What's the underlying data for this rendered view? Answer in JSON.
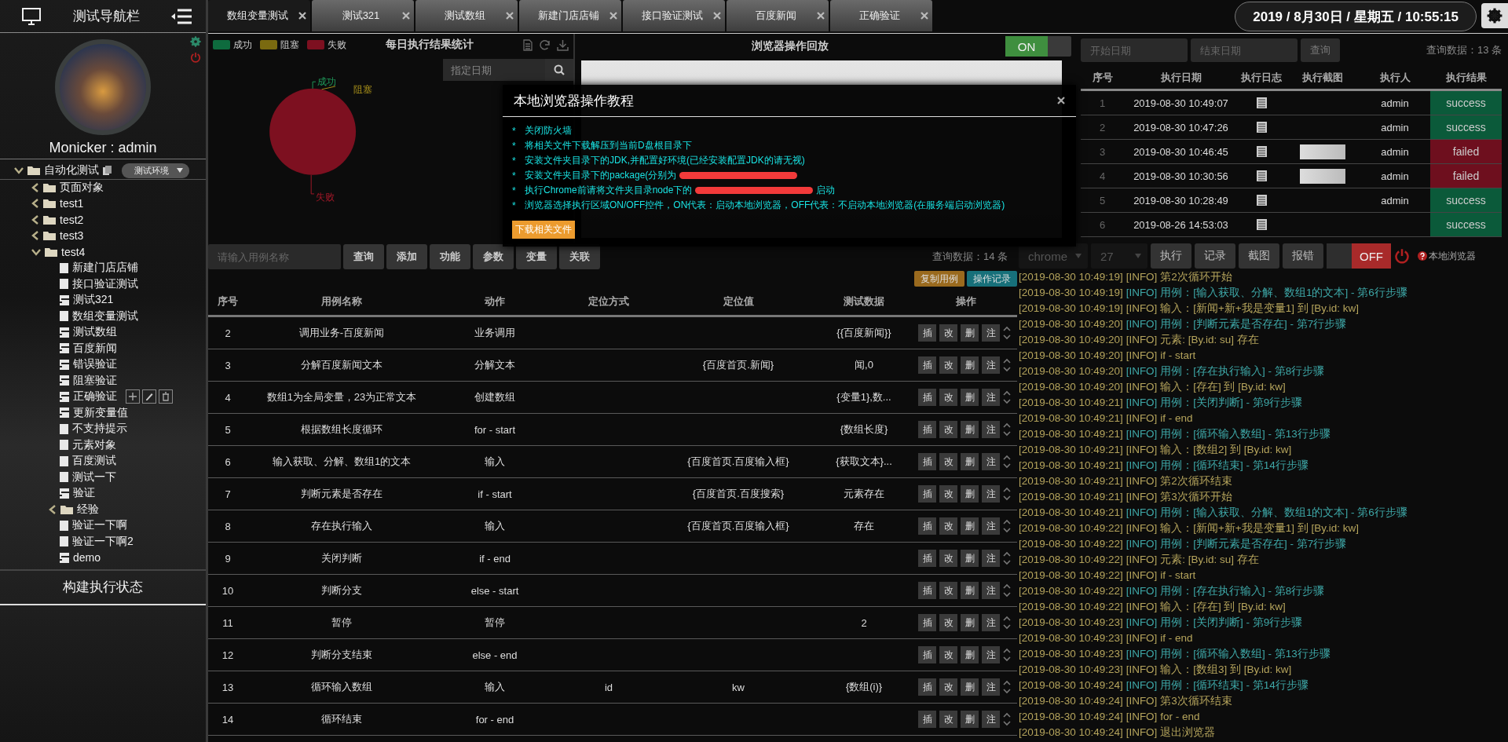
{
  "sidebar": {
    "title": "测试导航栏",
    "user": "Monicker : admin",
    "section": "构建执行状态",
    "tree": [
      {
        "label": "自动化测试",
        "kind": "folder",
        "expanded": true,
        "env": "测试环境",
        "children": [
          {
            "label": "页面对象",
            "kind": "folder",
            "expanded": false
          },
          {
            "label": "test1",
            "kind": "folder",
            "expanded": false
          },
          {
            "label": "test2",
            "kind": "folder",
            "expanded": false
          },
          {
            "label": "test3",
            "kind": "folder",
            "expanded": false
          },
          {
            "label": "test4",
            "kind": "folder",
            "expanded": true,
            "children": [
              {
                "label": "新建门店店铺",
                "kind": "doc",
                "hovered": false
              },
              {
                "label": "接口验证测试",
                "kind": "doc",
                "hovered": false
              },
              {
                "label": "测试321",
                "kind": "script",
                "hovered": false
              },
              {
                "label": "数组变量测试",
                "kind": "doc",
                "hovered": false
              },
              {
                "label": "测试数组",
                "kind": "script",
                "hovered": false
              },
              {
                "label": "百度新闻",
                "kind": "script",
                "hovered": false
              },
              {
                "label": "错误验证",
                "kind": "script",
                "hovered": false
              },
              {
                "label": "阻塞验证",
                "kind": "script",
                "hovered": false
              },
              {
                "label": "正确验证",
                "kind": "script",
                "hovered": true
              },
              {
                "label": "更新变量值",
                "kind": "script",
                "hovered": false
              },
              {
                "label": "不支持提示",
                "kind": "doc",
                "hovered": false
              },
              {
                "label": "元素对象",
                "kind": "doc",
                "hovered": false
              },
              {
                "label": "百度测试",
                "kind": "doc",
                "hovered": false
              },
              {
                "label": "测试一下",
                "kind": "doc",
                "hovered": false
              },
              {
                "label": "验证",
                "kind": "script",
                "hovered": false
              },
              {
                "label": "经验",
                "kind": "folder",
                "expanded": false
              },
              {
                "label": "验证一下啊",
                "kind": "doc",
                "hovered": false
              },
              {
                "label": "验证一下啊2",
                "kind": "doc",
                "hovered": false
              },
              {
                "label": "demo",
                "kind": "script",
                "hovered": false
              }
            ]
          }
        ]
      }
    ]
  },
  "tabs": [
    {
      "label": "数组变量测试",
      "selected": true
    },
    {
      "label": "测试321",
      "selected": false
    },
    {
      "label": "测试数组",
      "selected": false
    },
    {
      "label": "新建门店店铺",
      "selected": false
    },
    {
      "label": "接口验证测试",
      "selected": false
    },
    {
      "label": "百度新闻",
      "selected": false
    },
    {
      "label": "正确验证",
      "selected": false
    }
  ],
  "datetime": "2019 / 8月30日 / 星期五 / 10:55:15",
  "stats": {
    "title": "每日执行结果统计",
    "date_placeholder": "指定日期",
    "legend": [
      {
        "label": "成功",
        "color": "#0e6b3e"
      },
      {
        "label": "阻塞",
        "color": "#7a6a10"
      },
      {
        "label": "失败",
        "color": "#7d1020"
      }
    ],
    "pie_labels": [
      {
        "label": "成功",
        "color": "#1f9a5a"
      },
      {
        "label": "阻塞",
        "color": "#a8901a"
      },
      {
        "label": "失败",
        "color": "#a01828"
      }
    ]
  },
  "replay": {
    "title": "浏览器操作回放",
    "toggle": {
      "label": "ON",
      "on": true
    }
  },
  "results": {
    "start_placeholder": "开始日期",
    "end_placeholder": "结束日期",
    "query": "查询",
    "count": "查询数据：13 条",
    "columns": [
      "序号",
      "执行日期",
      "执行日志",
      "执行截图",
      "执行人",
      "执行结果"
    ],
    "rows": [
      {
        "index": "1",
        "date": "2019-08-30 10:49:07",
        "screenshot": false,
        "user": "admin",
        "result": "success",
        "color": "#0b5a3a"
      },
      {
        "index": "2",
        "date": "2019-08-30 10:47:26",
        "screenshot": false,
        "user": "admin",
        "result": "success",
        "color": "#0b5a3a"
      },
      {
        "index": "3",
        "date": "2019-08-30 10:46:45",
        "screenshot": true,
        "user": "admin",
        "result": "failed",
        "color": "#6e0f1e"
      },
      {
        "index": "4",
        "date": "2019-08-30 10:30:56",
        "screenshot": true,
        "user": "admin",
        "result": "failed",
        "color": "#6e0f1e"
      },
      {
        "index": "5",
        "date": "2019-08-30 10:28:49",
        "screenshot": false,
        "user": "admin",
        "result": "success",
        "color": "#0b5a3a"
      },
      {
        "index": "6",
        "date": "2019-08-26 14:53:03",
        "screenshot": false,
        "result": "success",
        "color": "#0b5a3a"
      }
    ]
  },
  "cases": {
    "search_placeholder": "请输入用例名称",
    "buttons": [
      "查询",
      "添加",
      "功能",
      "参数",
      "变量",
      "关联"
    ],
    "count": "查询数据：14 条",
    "extra_buttons": [
      {
        "label": "复制用例",
        "color": "#9a6a1e"
      },
      {
        "label": "操作记录",
        "color": "#17707a"
      }
    ],
    "columns": [
      "序号",
      "用例名称",
      "动作",
      "定位方式",
      "定位值",
      "测试数据",
      "操作"
    ],
    "rows": [
      {
        "no": "2",
        "name": "调用业务-百度新闻",
        "action": "业务调用",
        "test_data": "{{百度新闻}}",
        "actions": [
          "插",
          "改",
          "删",
          "注"
        ]
      },
      {
        "no": "3",
        "name": "分解百度新闻文本",
        "action": "分解文本",
        "locator_value": "{百度首页.新闻}",
        "test_data": "闻,0",
        "actions": [
          "插",
          "改",
          "删",
          "注"
        ]
      },
      {
        "no": "4",
        "name": "数组1为全局变量，23为正常文本",
        "action": "创建数组",
        "test_data": "{变量1},数...",
        "actions": [
          "插",
          "改",
          "删",
          "注"
        ]
      },
      {
        "no": "5",
        "name": "根据数组长度循环",
        "action": "for - start",
        "test_data": "{数组长度}",
        "actions": [
          "插",
          "改",
          "删",
          "注"
        ]
      },
      {
        "no": "6",
        "name": "输入获取、分解、数组1的文本",
        "action": "输入",
        "locator_value": "{百度首页.百度输入框}",
        "test_data": "{获取文本}...",
        "actions": [
          "插",
          "改",
          "删",
          "注"
        ]
      },
      {
        "no": "7",
        "name": "判断元素是否存在",
        "action": "if - start",
        "locator_value": "{百度首页.百度搜索}",
        "test_data": "元素存在",
        "actions": [
          "插",
          "改",
          "删",
          "注"
        ]
      },
      {
        "no": "8",
        "name": "存在执行输入",
        "action": "输入",
        "locator_value": "{百度首页.百度输入框}",
        "test_data": "存在",
        "actions": [
          "插",
          "改",
          "删",
          "注"
        ]
      },
      {
        "no": "9",
        "name": "关闭判断",
        "action": "if - end",
        "actions": [
          "插",
          "改",
          "删",
          "注"
        ]
      },
      {
        "no": "10",
        "name": "判断分支",
        "action": "else - start",
        "actions": [
          "插",
          "改",
          "删",
          "注"
        ]
      },
      {
        "no": "11",
        "name": "暂停",
        "action": "暂停",
        "test_data": "2",
        "actions": [
          "插",
          "改",
          "删",
          "注"
        ]
      },
      {
        "no": "12",
        "name": "判断分支结束",
        "action": "else - end",
        "actions": [
          "插",
          "改",
          "删",
          "注"
        ]
      },
      {
        "no": "13",
        "name": "循环输入数组",
        "action": "输入",
        "locator_type": "id",
        "locator_value": "kw",
        "test_data": "{数组(i)}",
        "actions": [
          "插",
          "改",
          "删",
          "注"
        ]
      },
      {
        "no": "14",
        "name": "循环结束",
        "action": "for - end",
        "actions": [
          "插",
          "改",
          "删",
          "注"
        ]
      }
    ]
  },
  "browser": {
    "selects": [
      "chrome",
      "27"
    ],
    "buttons": [
      "执行",
      "记录",
      "截图",
      "报错"
    ],
    "toggle": {
      "label": "OFF",
      "on": false
    },
    "help": "本地浏览器"
  },
  "log": [
    {
      "time": "[2019-08-30 10:49:19]",
      "level": "[INFO]",
      "message": "第2次循环开始",
      "kind": "info"
    },
    {
      "time": "[2019-08-30 10:49:19]",
      "level": "[INFO]",
      "message": "用例：[输入获取、分解、数组1的文本] - 第6行步骤",
      "kind": "case"
    },
    {
      "time": "[2019-08-30 10:49:19]",
      "level": "[INFO]",
      "message": "输入：[新闻+新+我是变量1] 到 [By.id: kw]",
      "kind": "info"
    },
    {
      "time": "[2019-08-30 10:49:20]",
      "level": "[INFO]",
      "message": "用例：[判断元素是否存在] - 第7行步骤",
      "kind": "case"
    },
    {
      "time": "[2019-08-30 10:49:20]",
      "level": "[INFO]",
      "message": "元素: [By.id: su] 存在",
      "kind": "info"
    },
    {
      "time": "[2019-08-30 10:49:20]",
      "level": "[INFO]",
      "message": "if - start",
      "kind": "info"
    },
    {
      "time": "[2019-08-30 10:49:20]",
      "level": "[INFO]",
      "message": "用例：[存在执行输入] - 第8行步骤",
      "kind": "case"
    },
    {
      "time": "[2019-08-30 10:49:20]",
      "level": "[INFO]",
      "message": "输入：[存在] 到 [By.id: kw]",
      "kind": "info"
    },
    {
      "time": "[2019-08-30 10:49:21]",
      "level": "[INFO]",
      "message": "用例：[关闭判断] - 第9行步骤",
      "kind": "case"
    },
    {
      "time": "[2019-08-30 10:49:21]",
      "level": "[INFO]",
      "message": "if - end",
      "kind": "info"
    },
    {
      "time": "[2019-08-30 10:49:21]",
      "level": "[INFO]",
      "message": "用例：[循环输入数组] - 第13行步骤",
      "kind": "case"
    },
    {
      "time": "[2019-08-30 10:49:21]",
      "level": "[INFO]",
      "message": "输入：[数组2] 到 [By.id: kw]",
      "kind": "info"
    },
    {
      "time": "[2019-08-30 10:49:21]",
      "level": "[INFO]",
      "message": "用例：[循环结束] - 第14行步骤",
      "kind": "case"
    },
    {
      "time": "[2019-08-30 10:49:21]",
      "level": "[INFO]",
      "message": "第2次循环结束",
      "kind": "info"
    },
    {
      "time": "[2019-08-30 10:49:21]",
      "level": "[INFO]",
      "message": "第3次循环开始",
      "kind": "info"
    },
    {
      "time": "[2019-08-30 10:49:21]",
      "level": "[INFO]",
      "message": "用例：[输入获取、分解、数组1的文本] - 第6行步骤",
      "kind": "case"
    },
    {
      "time": "[2019-08-30 10:49:22]",
      "level": "[INFO]",
      "message": "输入：[新闻+新+我是变量1] 到 [By.id: kw]",
      "kind": "info"
    },
    {
      "time": "[2019-08-30 10:49:22]",
      "level": "[INFO]",
      "message": "用例：[判断元素是否存在] - 第7行步骤",
      "kind": "case"
    },
    {
      "time": "[2019-08-30 10:49:22]",
      "level": "[INFO]",
      "message": "元素: [By.id: su] 存在",
      "kind": "info"
    },
    {
      "time": "[2019-08-30 10:49:22]",
      "level": "[INFO]",
      "message": "if - start",
      "kind": "info"
    },
    {
      "time": "[2019-08-30 10:49:22]",
      "level": "[INFO]",
      "message": "用例：[存在执行输入] - 第8行步骤",
      "kind": "case"
    },
    {
      "time": "[2019-08-30 10:49:22]",
      "level": "[INFO]",
      "message": "输入：[存在] 到 [By.id: kw]",
      "kind": "info"
    },
    {
      "time": "[2019-08-30 10:49:23]",
      "level": "[INFO]",
      "message": "用例：[关闭判断] - 第9行步骤",
      "kind": "case"
    },
    {
      "time": "[2019-08-30 10:49:23]",
      "level": "[INFO]",
      "message": "if - end",
      "kind": "info"
    },
    {
      "time": "[2019-08-30 10:49:23]",
      "level": "[INFO]",
      "message": "用例：[循环输入数组] - 第13行步骤",
      "kind": "case"
    },
    {
      "time": "[2019-08-30 10:49:23]",
      "level": "[INFO]",
      "message": "输入：[数组3] 到 [By.id: kw]",
      "kind": "info"
    },
    {
      "time": "[2019-08-30 10:49:24]",
      "level": "[INFO]",
      "message": "用例：[循环结束] - 第14行步骤",
      "kind": "case"
    },
    {
      "time": "[2019-08-30 10:49:24]",
      "level": "[INFO]",
      "message": "第3次循环结束",
      "kind": "info"
    },
    {
      "time": "[2019-08-30 10:49:24]",
      "level": "[INFO]",
      "message": "for - end",
      "kind": "info"
    },
    {
      "time": "[2019-08-30 10:49:24]",
      "level": "[INFO]",
      "message": "退出浏览器",
      "kind": "info"
    }
  ],
  "modal": {
    "title": "本地浏览器操作教程",
    "download": "下载相关文件",
    "items": [
      {
        "bullet": "*",
        "text": "关闭防火墙",
        "redacted": false
      },
      {
        "bullet": "*",
        "text": "将相关文件下载解压到当前D盘根目录下",
        "redacted": false
      },
      {
        "bullet": "*",
        "text": "安装文件夹目录下的JDK,并配置好环境(已经安装配置JDK的请无视)",
        "redacted": false
      },
      {
        "bullet": "*",
        "text": "安装文件夹目录下的package(分别为",
        "redacted": true
      },
      {
        "bullet": "*",
        "text": "执行Chrome前请将文件夹目录node下的",
        "redacted": true,
        "tail": "启动"
      },
      {
        "bullet": "*",
        "text": "浏览器选择执行区域ON/OFF控件，ON代表：启动本地浏览器，OFF代表：不启动本地浏览器(在服务端启动浏览器)",
        "redacted": false
      }
    ]
  }
}
